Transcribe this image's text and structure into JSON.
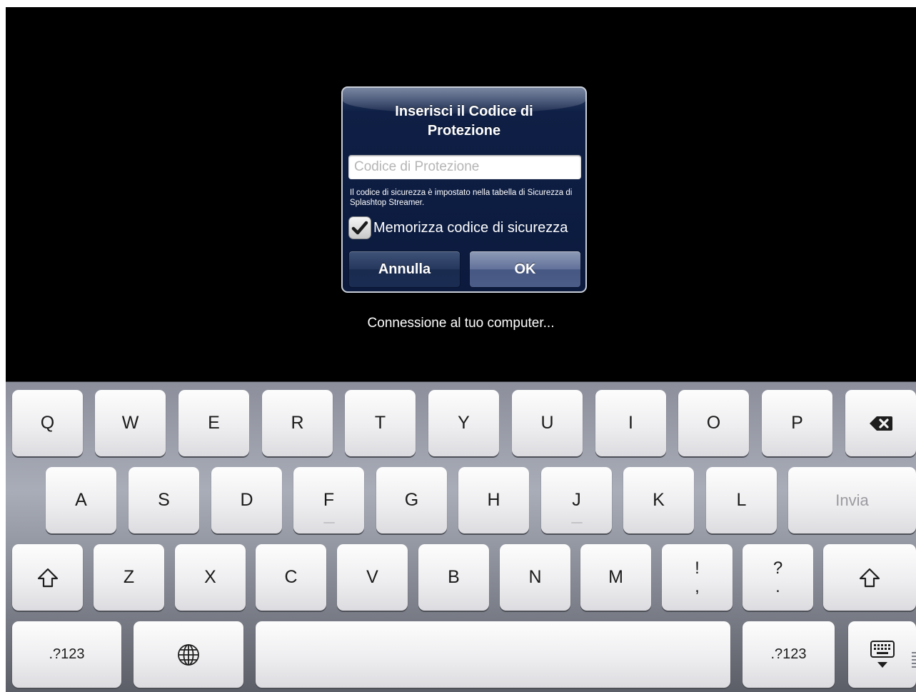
{
  "dialog": {
    "title_line1": "Inserisci il Codice di",
    "title_line2": "Protezione",
    "input_placeholder": "Codice di Protezione",
    "input_value": "",
    "hint": "Il codice di sicurezza è impostato nella tabella di Sicurezza di Splashtop Streamer.",
    "remember_label": "Memorizza codice di sicurezza",
    "remember_checked": true,
    "cancel_label": "Annulla",
    "ok_label": "OK"
  },
  "status": "Connessione al tuo computer...",
  "keyboard": {
    "row1": [
      "Q",
      "W",
      "E",
      "R",
      "T",
      "Y",
      "U",
      "I",
      "O",
      "P"
    ],
    "row2": [
      "A",
      "S",
      "D",
      "F",
      "G",
      "H",
      "J",
      "K",
      "L"
    ],
    "row3": [
      "Z",
      "X",
      "C",
      "V",
      "B",
      "N",
      "M"
    ],
    "punct1": {
      "top": "!",
      "bottom": ","
    },
    "punct2": {
      "top": "?",
      "bottom": "."
    },
    "return_label": "Invia",
    "numbers_label": ".?123",
    "icons": [
      "backspace-icon",
      "shift-icon",
      "globe-icon",
      "keyboard-dismiss-icon",
      "checkmark-icon"
    ]
  }
}
